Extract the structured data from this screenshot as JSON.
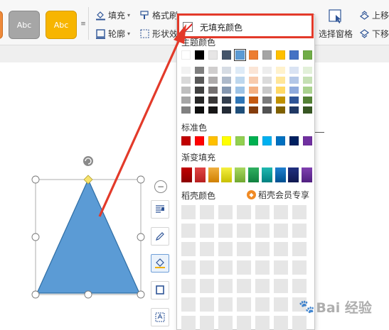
{
  "ribbon": {
    "style_gallery": [
      "Abc",
      "Abc"
    ],
    "fill_label": "填充",
    "outline_label": "轮廓",
    "format_brush_label": "格式刷",
    "shape_effect_label": "形状效",
    "select_pane_label": "选择窗格",
    "move_up_label": "上移",
    "move_down_label": "下移",
    "dropdown_arrow": "▾",
    "gallery_more": "≡"
  },
  "fill_panel": {
    "no_fill": "无填充颜色",
    "theme_label": "主题颜色",
    "standard_label": "标准色",
    "gradient_label": "渐变填充",
    "dake_label": "稻壳颜色",
    "dake_member_label": "稻壳会员专享",
    "theme_top": [
      "#ffffff",
      "#000000",
      "#e7e6e6",
      "#44546a",
      "#5b9bd5",
      "#ed7d31",
      "#a5a5a5",
      "#ffc000",
      "#4472c4",
      "#70ad47"
    ],
    "theme_shades": [
      [
        "#f2f2f2",
        "#d9d9d9",
        "#bfbfbf",
        "#a6a6a6",
        "#808080"
      ],
      [
        "#7f7f7f",
        "#595959",
        "#404040",
        "#262626",
        "#0d0d0d"
      ],
      [
        "#d0cece",
        "#aeabab",
        "#757171",
        "#3a3838",
        "#171616"
      ],
      [
        "#d6dce4",
        "#adb9ca",
        "#8497b0",
        "#333f4f",
        "#222a35"
      ],
      [
        "#deebf7",
        "#bdd7ee",
        "#9dc3e6",
        "#2e75b6",
        "#1f4e79"
      ],
      [
        "#fbe5d6",
        "#f8cbad",
        "#f4b183",
        "#c55a11",
        "#843c0c"
      ],
      [
        "#ededed",
        "#dbdbdb",
        "#c9c9c9",
        "#7b7b7b",
        "#525252"
      ],
      [
        "#fff2cc",
        "#ffe699",
        "#ffd966",
        "#bf9000",
        "#7f6000"
      ],
      [
        "#dae3f3",
        "#b4c7e7",
        "#8faadc",
        "#2f5597",
        "#203864"
      ],
      [
        "#e2f0d9",
        "#c5e0b4",
        "#a9d18e",
        "#538135",
        "#375623"
      ]
    ],
    "standard": [
      "#c00000",
      "#ff0000",
      "#ffc000",
      "#ffff00",
      "#92d050",
      "#00b050",
      "#00b0f0",
      "#0070c0",
      "#002060",
      "#7030a0"
    ],
    "gradient": [
      [
        "#c00000",
        "#8b0000"
      ],
      [
        "#e04545",
        "#b82020"
      ],
      [
        "#f0b040",
        "#d08000"
      ],
      [
        "#f5f040",
        "#c8c000"
      ],
      [
        "#a8d860",
        "#70a830"
      ],
      [
        "#30b060",
        "#108040"
      ],
      [
        "#20b8b0",
        "#008080"
      ],
      [
        "#2080d0",
        "#005090"
      ],
      [
        "#203080",
        "#101850"
      ],
      [
        "#8040b0",
        "#502080"
      ]
    ]
  },
  "watermark": {
    "text": "Bai  经验",
    "paw": "🐾"
  },
  "colors": {
    "shape_fill": "#5b9bd5",
    "shape_stroke": "#2e6da4",
    "annotation_red": "#e33a2a",
    "handle_yellow": "#f7e26b"
  }
}
